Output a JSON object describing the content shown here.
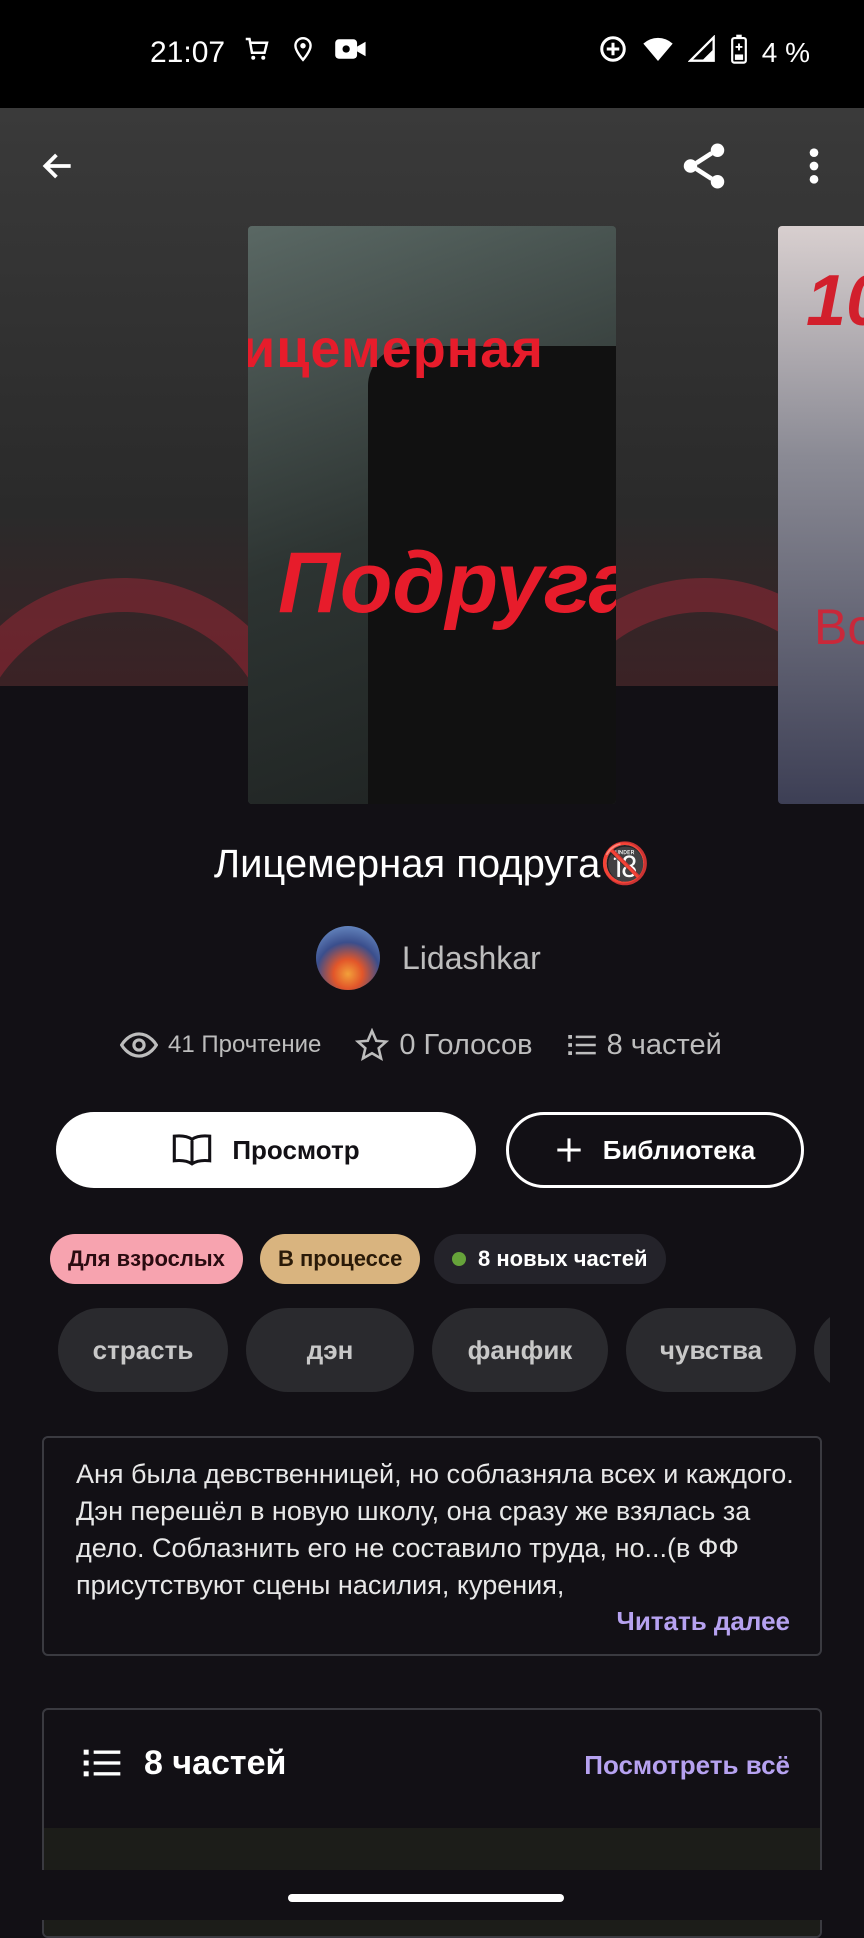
{
  "status": {
    "time": "21:07",
    "battery": "4 %"
  },
  "cover": {
    "line1": "ицемерная",
    "line2": "Подруга",
    "next_num": "10",
    "next_text": "Во"
  },
  "book": {
    "title": "Лицемерная подруга🔞",
    "author": "Lidashkar"
  },
  "stats": {
    "reads": "41 Прочтение",
    "votes": "0 Голосов",
    "parts": "8 частей"
  },
  "buttons": {
    "view": "Просмотр",
    "library": "Библиотека"
  },
  "badges": {
    "adult": "Для взрослых",
    "progress": "В процессе",
    "new_parts": "8 новых частей"
  },
  "tags": [
    "страсть",
    "дэн",
    "фанфик",
    "чувства"
  ],
  "description": {
    "text": "Аня была девственницей, но соблазняла всех и каждого. Дэн перешёл в новую школу, она сразу же взялась за дело. Соблазнить его не составило труда, но...(в ФФ присутствуют сцены насилия, курения,",
    "read_more": "Читать далее"
  },
  "parts_section": {
    "title": "8 частей",
    "see_all": "Посмотреть всё"
  },
  "colors": {
    "accent": "#b6a2f0",
    "adult_badge": "#f7a3af",
    "progress_badge": "#d9b47f",
    "new_dot": "#66a33a"
  }
}
